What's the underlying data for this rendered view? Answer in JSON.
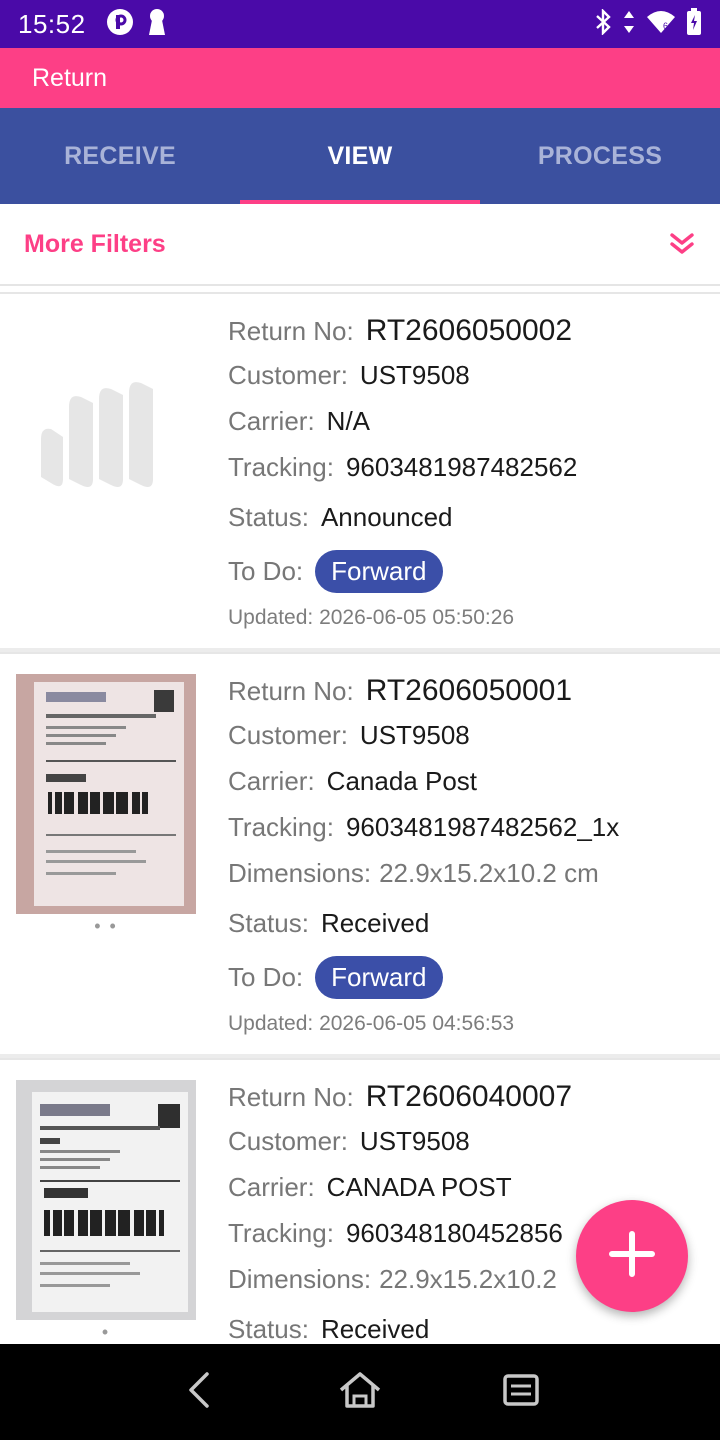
{
  "status_bar": {
    "time": "15:52",
    "icons": [
      "p-badge-icon",
      "keyhole-icon",
      "bluetooth-icon",
      "data-arrows-icon",
      "wifi-icon",
      "battery-icon"
    ]
  },
  "app_bar": {
    "title": "Return"
  },
  "tabs": [
    {
      "label": "RECEIVE",
      "active": false
    },
    {
      "label": "VIEW",
      "active": true
    },
    {
      "label": "PROCESS",
      "active": false
    }
  ],
  "filters": {
    "label": "More Filters",
    "icon": "double-chevron-down-icon"
  },
  "labels": {
    "return_no": "Return No:",
    "customer": "Customer:",
    "carrier": "Carrier:",
    "tracking": "Tracking:",
    "dimensions": "Dimensions:",
    "status": "Status:",
    "todo": "To Do:"
  },
  "returns": [
    {
      "return_no": "RT2606050002",
      "customer": "UST9508",
      "carrier": "N/A",
      "tracking": "9603481987482562",
      "status": "Announced",
      "todo": "Forward",
      "updated": "Updated: 2026-06-05 05:50:26",
      "thumb": "placeholder-logo"
    },
    {
      "return_no": "RT2606050001",
      "customer": "UST9508",
      "carrier": "Canada Post",
      "tracking": "9603481987482562_1x",
      "dimensions": "22.9x15.2x10.2 cm",
      "status": "Received",
      "todo": "Forward",
      "updated": "Updated: 2026-06-05 04:56:53",
      "thumb": "parcel-photo",
      "dots": "• •"
    },
    {
      "return_no": "RT2606040007",
      "customer": "UST9508",
      "carrier": "CANADA POST",
      "tracking": "960348180452856",
      "dimensions": "22.9x15.2x10.2",
      "status": "Received",
      "thumb": "parcel-photo",
      "dots": "•"
    }
  ],
  "fab": {
    "icon": "plus-icon"
  },
  "nav": {
    "icons": [
      "back-icon",
      "home-icon",
      "recents-icon"
    ]
  },
  "colors": {
    "status_bar": "#4a0aa8",
    "accent": "#fd3f86",
    "tabs": "#3b509f",
    "chip": "#3b4fa8"
  }
}
